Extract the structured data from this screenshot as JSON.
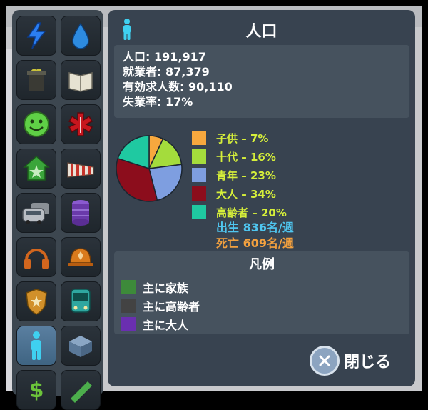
{
  "panel": {
    "title": "人口",
    "stats": {
      "population": "人口: 191,917",
      "workers": "就業者: 87,379",
      "job_seekers": "有効求人数: 90,110",
      "unemployment": "失業率: 17%"
    },
    "age_groups": [
      {
        "label": "子供 – 7%",
        "color": "#f7a83e",
        "percent": 7
      },
      {
        "label": "十代 – 16%",
        "color": "#a4dc3c",
        "percent": 16
      },
      {
        "label": "青年 – 23%",
        "color": "#7e9ee0",
        "percent": 23
      },
      {
        "label": "大人 – 34%",
        "color": "#8c0d1c",
        "percent": 34
      },
      {
        "label": "高齢者 – 20%",
        "color": "#1fc9a1",
        "percent": 20
      }
    ],
    "births": "出生 836名/週",
    "deaths": "死亡 609名/週",
    "births_color": "#4fc6f0",
    "deaths_color": "#f3a13f",
    "legend": {
      "title": "凡例",
      "items": [
        {
          "label": "主に家族",
          "color": "#3d8a3a"
        },
        {
          "label": "主に高齢者",
          "color": "#434343"
        },
        {
          "label": "主に大人",
          "color": "#6a2fb0"
        }
      ]
    },
    "close_label": "閉じる"
  },
  "sidebar": {
    "tools": [
      {
        "name": "electricity-icon"
      },
      {
        "name": "water-icon"
      },
      {
        "name": "garbage-icon"
      },
      {
        "name": "education-icon"
      },
      {
        "name": "happiness-icon"
      },
      {
        "name": "health-icon"
      },
      {
        "name": "land-value-icon"
      },
      {
        "name": "wind-icon"
      },
      {
        "name": "traffic-icon"
      },
      {
        "name": "resources-icon"
      },
      {
        "name": "noise-icon"
      },
      {
        "name": "fire-icon"
      },
      {
        "name": "police-icon"
      },
      {
        "name": "transport-icon"
      },
      {
        "name": "population-icon"
      },
      {
        "name": "buildings-icon"
      },
      {
        "name": "economy-icon"
      },
      {
        "name": "zoning-icon"
      }
    ]
  }
}
